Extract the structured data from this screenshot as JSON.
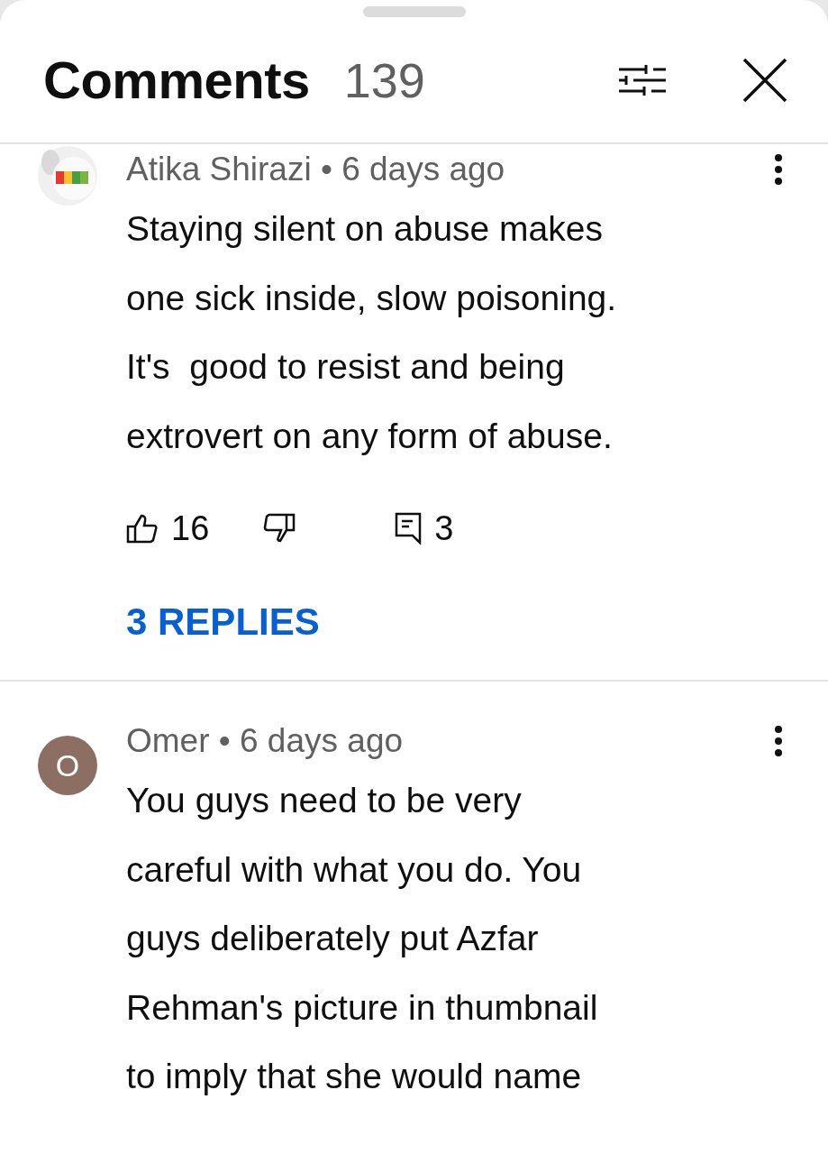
{
  "header": {
    "title": "Comments",
    "count": "139"
  },
  "comments": [
    {
      "meta": "Atika Shirazi • 6 days ago",
      "body": "Staying silent on abuse makes\none sick inside, slow poisoning.\nIt's  good to resist and being\nextrovert on any form of abuse.",
      "likes": "16",
      "replies_count": "3",
      "replies_link": "3 REPLIES"
    },
    {
      "meta": "Omer • 6 days ago",
      "avatar": {
        "kind": "letter",
        "letter": "O",
        "color": "#8d6e63"
      },
      "body": "You guys need to be very\ncareful with what you do. You\nguys deliberately put Azfar\nRehman's picture in thumbnail\nto imply that she would name"
    }
  ]
}
